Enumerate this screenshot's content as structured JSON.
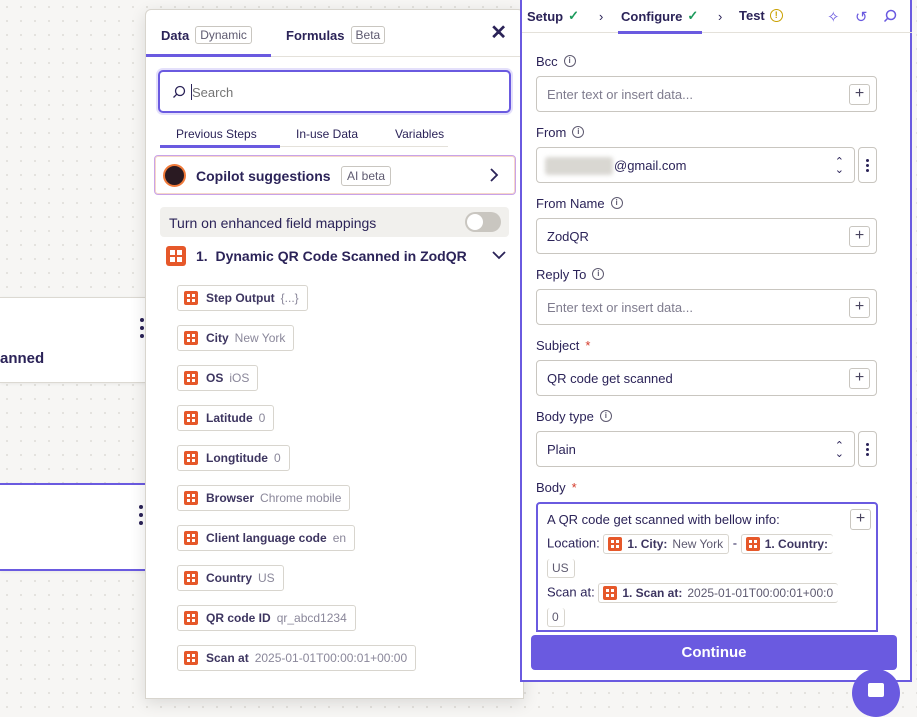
{
  "canvas": {
    "card1_title": "anned",
    "card2_title": ""
  },
  "data_panel": {
    "tabs": [
      {
        "label": "Data",
        "badge": "Dynamic"
      },
      {
        "label": "Formulas",
        "badge": "Beta"
      }
    ],
    "search_placeholder": "Search",
    "sub_tabs": [
      "Previous Steps",
      "In-use Data",
      "Variables"
    ],
    "copilot": {
      "title": "Copilot suggestions",
      "badge": "AI beta"
    },
    "enhanced_mappings": {
      "label": "Turn on enhanced field mappings",
      "enabled": false
    },
    "step": {
      "number": "1.",
      "title": "Dynamic QR Code Scanned in ZodQR"
    },
    "fields": [
      {
        "key": "Step Output",
        "value": "{...}"
      },
      {
        "key": "City",
        "value": "New York"
      },
      {
        "key": "OS",
        "value": "iOS"
      },
      {
        "key": "Latitude",
        "value": "0"
      },
      {
        "key": "Longtitude",
        "value": "0"
      },
      {
        "key": "Browser",
        "value": "Chrome mobile"
      },
      {
        "key": "Client language code",
        "value": "en"
      },
      {
        "key": "Country",
        "value": "US"
      },
      {
        "key": "QR code ID",
        "value": "qr_abcd1234"
      },
      {
        "key": "Scan at",
        "value": "2025-01-01T00:00:01+00:00"
      }
    ]
  },
  "config": {
    "breadcrumb": [
      {
        "label": "Setup",
        "status": "✓"
      },
      {
        "label": "Configure",
        "status": "✓"
      },
      {
        "label": "Test",
        "status": "!"
      }
    ],
    "bcc": {
      "label": "Bcc",
      "placeholder": "Enter text or insert data..."
    },
    "from": {
      "label": "From",
      "value": "@gmail.com"
    },
    "from_name": {
      "label": "From Name",
      "value": "ZodQR"
    },
    "reply_to": {
      "label": "Reply To",
      "placeholder": "Enter text or insert data..."
    },
    "subject": {
      "label": "Subject",
      "required": "*",
      "value": "QR code get scanned"
    },
    "body_type": {
      "label": "Body type",
      "value": "Plain"
    },
    "body": {
      "label": "Body",
      "required": "*",
      "line1": "A QR code get scanned with bellow info:",
      "location_label": "Location:",
      "city_pill": {
        "key": "1. City:",
        "value": "New York"
      },
      "dash": "-",
      "country_pill": {
        "key": "1. Country:",
        "value": "US"
      },
      "scan_label": "Scan at:",
      "scan_pill": {
        "key": "1. Scan at:",
        "value": "2025-01-01T00:00:01+00:0",
        "overflow": "0"
      }
    },
    "continue_label": "Continue"
  },
  "colors": {
    "accent": "#6a5ae0",
    "zodqr": "#e6582a",
    "success": "#1c9a5c"
  }
}
